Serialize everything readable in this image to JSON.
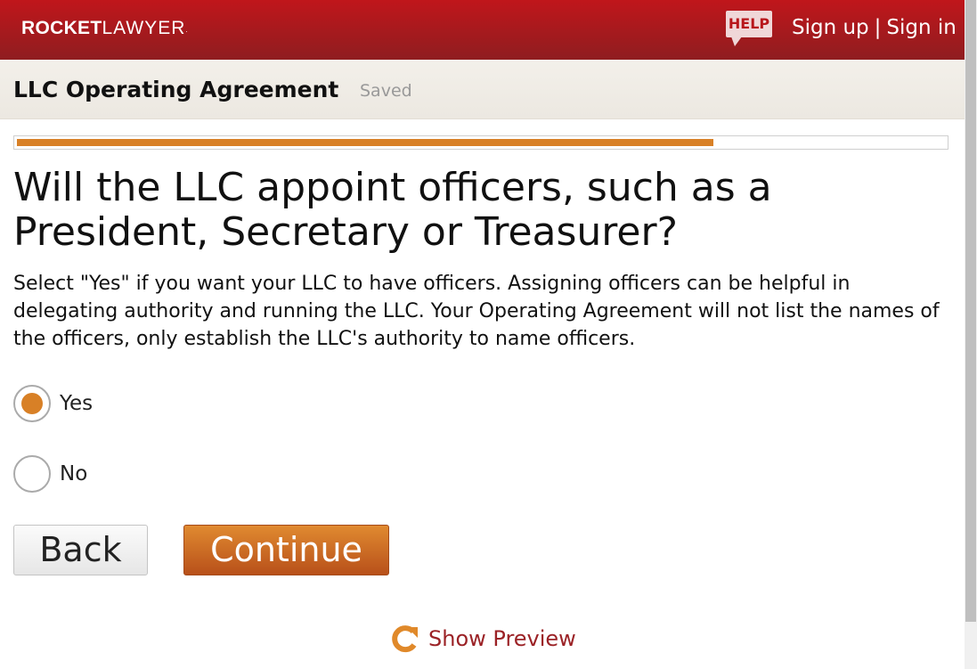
{
  "header": {
    "logo_bold": "ROCKET",
    "logo_light": "LAWYER",
    "logo_mark": ".",
    "help_label": "HELP",
    "sign_up": "Sign up",
    "separator": "|",
    "sign_in": "Sign in"
  },
  "document": {
    "title": "LLC Operating Agreement",
    "status": "Saved"
  },
  "progress": {
    "percent": 75
  },
  "question": {
    "title": "Will the LLC appoint officers, such as a President, Secretary or Treasurer?",
    "description": "Select \"Yes\" if you want your LLC to have officers. Assigning officers can be helpful in delegating authority and running the LLC. Your Operating Agreement will not list the names of the officers, only establish the LLC's authority to name officers.",
    "options": [
      {
        "label": "Yes",
        "selected": true
      },
      {
        "label": "No",
        "selected": false
      }
    ]
  },
  "actions": {
    "back_label": "Back",
    "continue_label": "Continue",
    "preview_label": "Show Preview",
    "preview_icon": "refresh-icon"
  },
  "colors": {
    "brand_red": "#c0161b",
    "accent_orange": "#d88026",
    "link_red": "#9b2226"
  }
}
